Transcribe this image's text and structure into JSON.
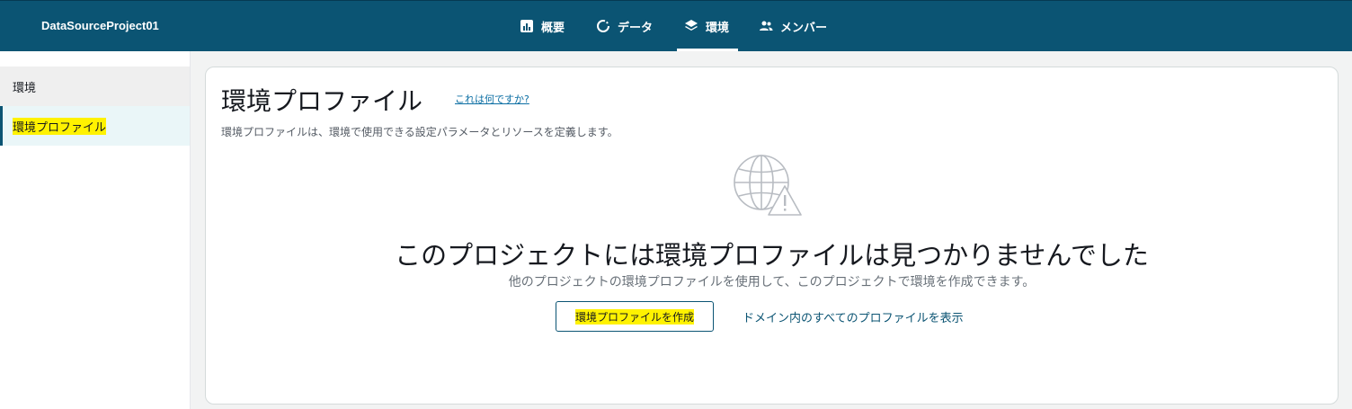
{
  "header": {
    "project_name": "DataSourceProject01",
    "tabs": [
      {
        "label": "概要",
        "icon": "bar-chart-icon"
      },
      {
        "label": "データ",
        "icon": "circle-refresh-icon"
      },
      {
        "label": "環境",
        "icon": "layers-icon",
        "active": true
      },
      {
        "label": "メンバー",
        "icon": "users-icon"
      }
    ]
  },
  "sidebar": {
    "items": [
      {
        "label": "環境"
      },
      {
        "label": "環境プロファイル",
        "selected": true
      }
    ]
  },
  "main": {
    "title": "環境プロファイル",
    "help_link": "これは何ですか?",
    "description": "環境プロファイルは、環境で使用できる設定パラメータとリソースを定義します。",
    "empty_state": {
      "icon": "globe-warning-icon",
      "title": "このプロジェクトには環境プロファイルは見つかりませんでした",
      "subtitle": "他のプロジェクトの環境プロファイルを使用して、このプロジェクトで環境を作成できます。",
      "create_button": "環境プロファイルを作成",
      "view_all_link": "ドメイン内のすべてのプロファイルを表示"
    }
  },
  "colors": {
    "nav_bg": "#0b5473",
    "accent": "#0b5473",
    "highlight": "#fff200"
  }
}
